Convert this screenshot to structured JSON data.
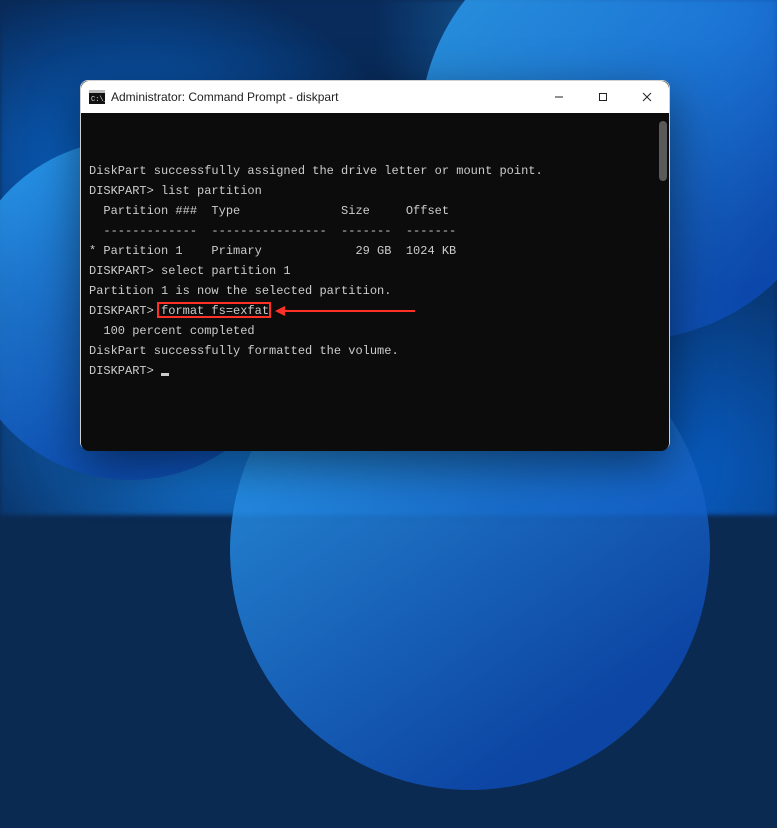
{
  "window": {
    "title": "Administrator: Command Prompt - diskpart"
  },
  "term": {
    "l1": "DiskPart successfully assigned the drive letter or mount point.",
    "l2": "",
    "l3": "DISKPART> list partition",
    "l4": "",
    "l5": "  Partition ###  Type              Size     Offset",
    "l6": "  -------------  ----------------  -------  -------",
    "l7": "* Partition 1    Primary             29 GB  1024 KB",
    "l8": "",
    "l9": "DISKPART> select partition 1",
    "l10": "",
    "l11": "Partition 1 is now the selected partition.",
    "l12": "",
    "l13a": "DISKPART> ",
    "l13b": "format fs=exfat",
    "l14": "",
    "l15": "  100 percent completed",
    "l16": "",
    "l17": "DiskPart successfully formatted the volume.",
    "l18": "",
    "l19": "DISKPART> "
  },
  "annotation": {
    "highlight_color": "#ff3126"
  }
}
